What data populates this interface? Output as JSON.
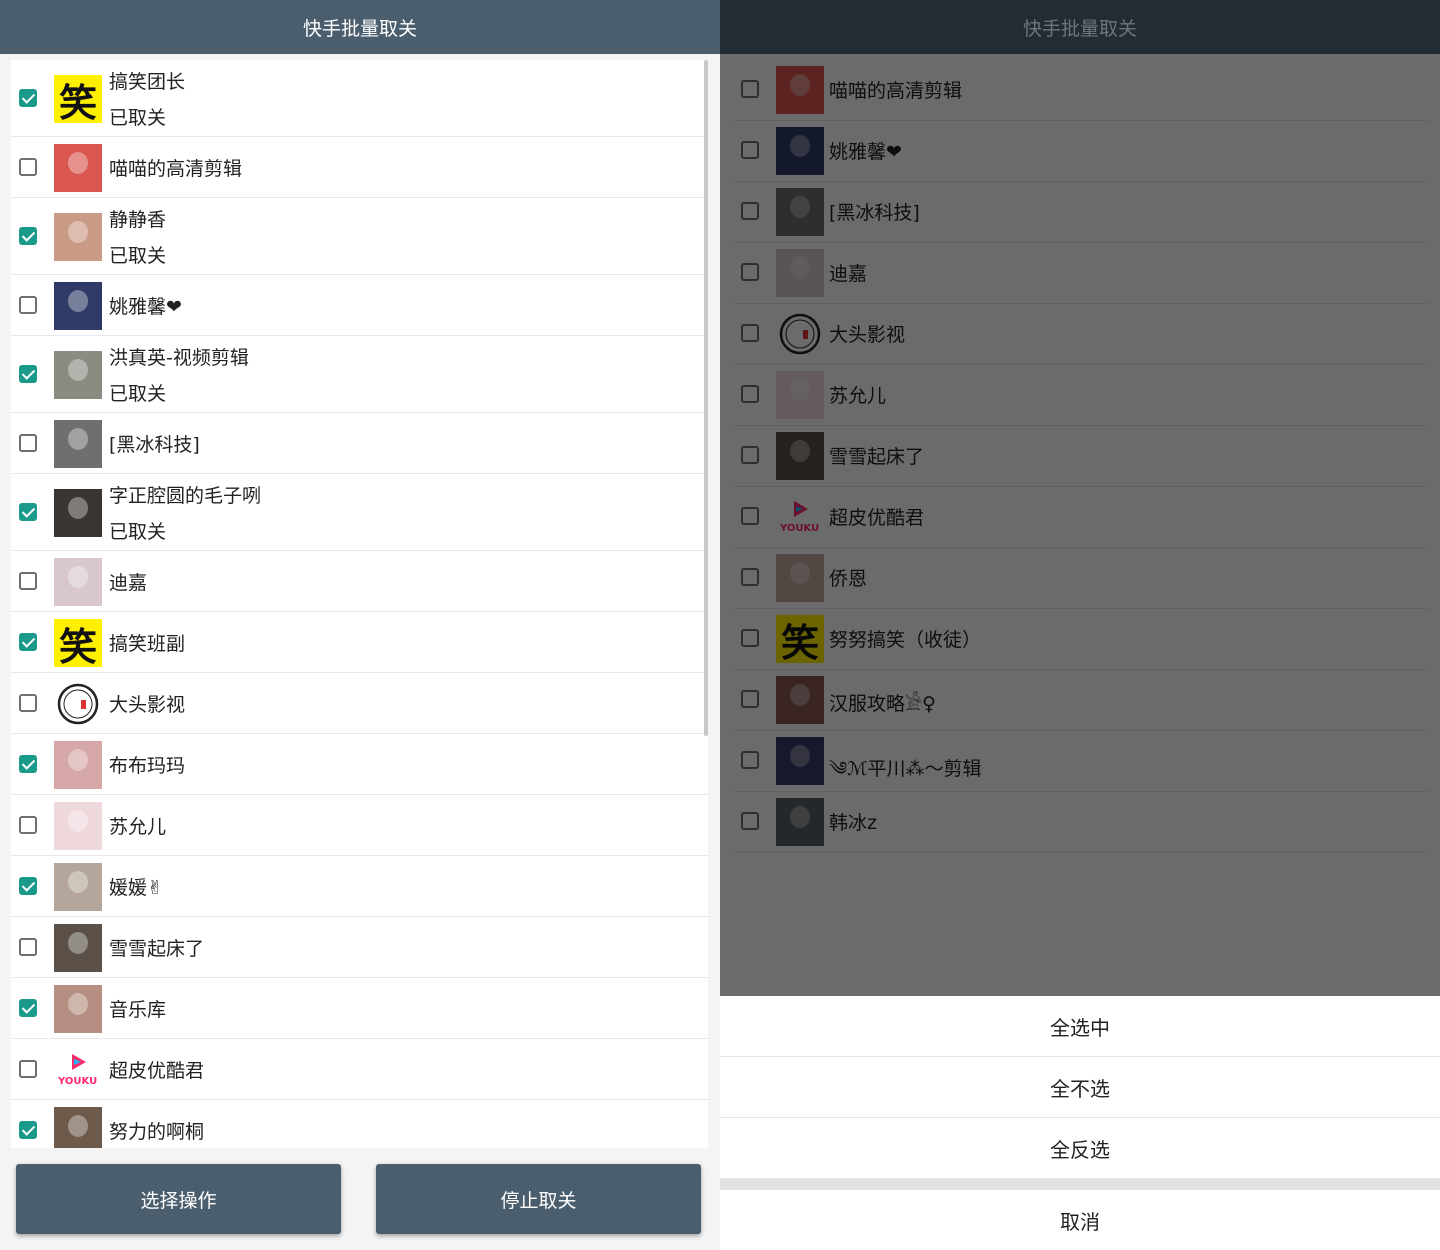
{
  "colors": {
    "accent": "#1a9a8a",
    "header": "#4b5e6e"
  },
  "left": {
    "title": "快手批量取关",
    "items": [
      {
        "name": "搞笑团长",
        "status": "已取关",
        "checked": true,
        "avatar_type": "xiao",
        "avatar_text": "笑",
        "avatar_color": "#ffef00"
      },
      {
        "name": "喵喵的高清剪辑",
        "status": "",
        "checked": false,
        "avatar_type": "photo",
        "avatar_color": "#d9574f"
      },
      {
        "name": "静静香",
        "status": "已取关",
        "checked": true,
        "avatar_type": "photo",
        "avatar_color": "#c99a86"
      },
      {
        "name": "姚雅馨❤",
        "status": "",
        "checked": false,
        "avatar_type": "photo",
        "avatar_color": "#2f3b66"
      },
      {
        "name": "洪真英-视频剪辑",
        "status": "已取关",
        "checked": true,
        "avatar_type": "photo",
        "avatar_color": "#8b8b82"
      },
      {
        "name": "[黑冰科技]",
        "status": "",
        "checked": false,
        "avatar_type": "photo",
        "avatar_color": "#6f6f6f"
      },
      {
        "name": "字正腔圆的毛子咧",
        "status": "已取关",
        "checked": true,
        "avatar_type": "photo",
        "avatar_color": "#3a3530"
      },
      {
        "name": "迪嘉",
        "status": "",
        "checked": false,
        "avatar_type": "photo",
        "avatar_color": "#d8c8cc"
      },
      {
        "name": "搞笑班副",
        "status": "",
        "checked": true,
        "avatar_type": "xiao",
        "avatar_text": "笑",
        "avatar_color": "#ffef00"
      },
      {
        "name": "大头影视",
        "status": "",
        "checked": false,
        "avatar_type": "datou",
        "avatar_color": "#ffffff"
      },
      {
        "name": "布布玛玛",
        "status": "",
        "checked": true,
        "avatar_type": "photo",
        "avatar_color": "#d7a8a8"
      },
      {
        "name": "苏允儿",
        "status": "",
        "checked": false,
        "avatar_type": "photo",
        "avatar_color": "#efd8dc"
      },
      {
        "name": "媛媛✌",
        "status": "",
        "checked": true,
        "avatar_type": "photo",
        "avatar_color": "#b4a69a"
      },
      {
        "name": "雪雪起床了",
        "status": "",
        "checked": false,
        "avatar_type": "photo",
        "avatar_color": "#5a5048"
      },
      {
        "name": "音乐库",
        "status": "",
        "checked": true,
        "avatar_type": "photo",
        "avatar_color": "#b68f82"
      },
      {
        "name": "超皮优酷君",
        "status": "",
        "checked": false,
        "avatar_type": "youku",
        "avatar_text": "YOUKU",
        "avatar_color": "#ffffff"
      },
      {
        "name": "努力的啊桐",
        "status": "",
        "checked": true,
        "avatar_type": "photo",
        "avatar_color": "#6e5a4a"
      }
    ],
    "buttons": {
      "select_ops": "选择操作",
      "stop": "停止取关"
    }
  },
  "right": {
    "title": "快手批量取关",
    "items": [
      {
        "name": "喵喵的高清剪辑",
        "checked": false,
        "avatar_type": "photo",
        "avatar_color": "#d9574f"
      },
      {
        "name": "姚雅馨❤",
        "checked": false,
        "avatar_type": "photo",
        "avatar_color": "#2f3b66"
      },
      {
        "name": "[黑冰科技]",
        "checked": false,
        "avatar_type": "photo",
        "avatar_color": "#6f6f6f"
      },
      {
        "name": "迪嘉",
        "checked": false,
        "avatar_type": "photo",
        "avatar_color": "#d8c8cc"
      },
      {
        "name": "大头影视",
        "checked": false,
        "avatar_type": "datou",
        "avatar_color": "#ffffff"
      },
      {
        "name": "苏允儿",
        "checked": false,
        "avatar_type": "photo",
        "avatar_color": "#efd8dc"
      },
      {
        "name": "雪雪起床了",
        "checked": false,
        "avatar_type": "photo",
        "avatar_color": "#5a5048"
      },
      {
        "name": "超皮优酷君",
        "checked": false,
        "avatar_type": "youku",
        "avatar_text": "YOUKU",
        "avatar_color": "#ffffff"
      },
      {
        "name": "侨恩",
        "checked": false,
        "avatar_type": "photo",
        "avatar_color": "#c0aaa0"
      },
      {
        "name": "努努搞笑（收徒）",
        "checked": false,
        "avatar_type": "xiao",
        "avatar_text": "笑",
        "avatar_color": "#ffef00"
      },
      {
        "name": "汉服攻略𓀀♀",
        "checked": false,
        "avatar_type": "photo",
        "avatar_color": "#8a5a55"
      },
      {
        "name": "༄ℳ平川⁂〜剪辑",
        "checked": false,
        "avatar_type": "photo",
        "avatar_color": "#3a3a6a"
      },
      {
        "name": "韩冰z",
        "checked": false,
        "avatar_type": "photo",
        "avatar_color": "#5a6066"
      }
    ],
    "sheet": {
      "select_all": "全选中",
      "select_none": "全不选",
      "invert": "全反选",
      "cancel": "取消"
    }
  }
}
